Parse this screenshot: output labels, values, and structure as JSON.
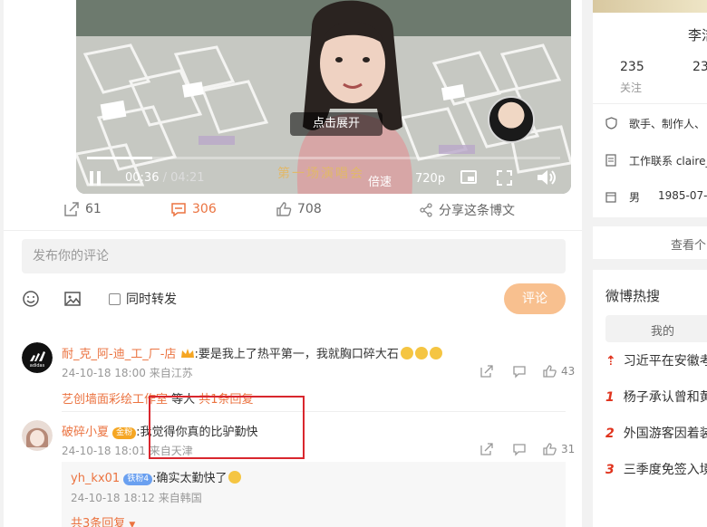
{
  "video": {
    "expand_tip": "点击展开",
    "watermark_text": "第一场演唱会",
    "time_current": "00:36",
    "time_total": " / 04:21",
    "speed_label": "倍速",
    "quality_label": "720p",
    "progress_fraction": 0.138
  },
  "actions": {
    "forward_count": "61",
    "comment_count": "306",
    "like_count": "708",
    "share_label": "分享这条博文"
  },
  "composer": {
    "placeholder": "发布你的评论",
    "repost_label": "同时转发",
    "submit_label": "评论"
  },
  "comments": [
    {
      "user": "耐_克_阿-迪_工_厂-店",
      "text": ":要是我上了热平第一，我就胸口碎大石",
      "date": "24-10-18 18:00",
      "location": "来自江苏",
      "likes": "43",
      "reply_prefix": "艺创墙面彩绘工作室",
      "reply_mid": " 等人 ",
      "reply_count": "共1条回复"
    },
    {
      "user": "破碎小夏",
      "badge": "金粉",
      "text": ":我觉得你真的比驴勤快",
      "date": "24-10-18 18:01",
      "location": "来自天津",
      "likes": "31"
    }
  ],
  "reply": {
    "user": "yh_kx01",
    "badge": "铁粉4",
    "text": ":确实太勤快了",
    "date": "24-10-18 18:12",
    "location": "来自韩国",
    "more": "共3条回复"
  },
  "sidebar": {
    "name_fragment": "李洁",
    "follow_count": "235",
    "follow_label": "关注",
    "fans_fragment": "23",
    "bio": "歌手、制作人、",
    "contact": "工作联系 claire_",
    "gender": "男",
    "birthday": "1985-07-",
    "view_more": "查看个",
    "hot_title": "微博热搜",
    "my_tab": "我的",
    "hot_items": [
      {
        "rank": "",
        "text": "习近平在安徽考"
      },
      {
        "rank": "1",
        "text": "杨子承认曾和黄"
      },
      {
        "rank": "2",
        "text": "外国游客因着装"
      },
      {
        "rank": "3",
        "text": "三季度免签入境"
      }
    ]
  },
  "colors": {
    "accent": "#eb7340",
    "highlight_box": "#d9272e",
    "rank": "#e0331d"
  }
}
